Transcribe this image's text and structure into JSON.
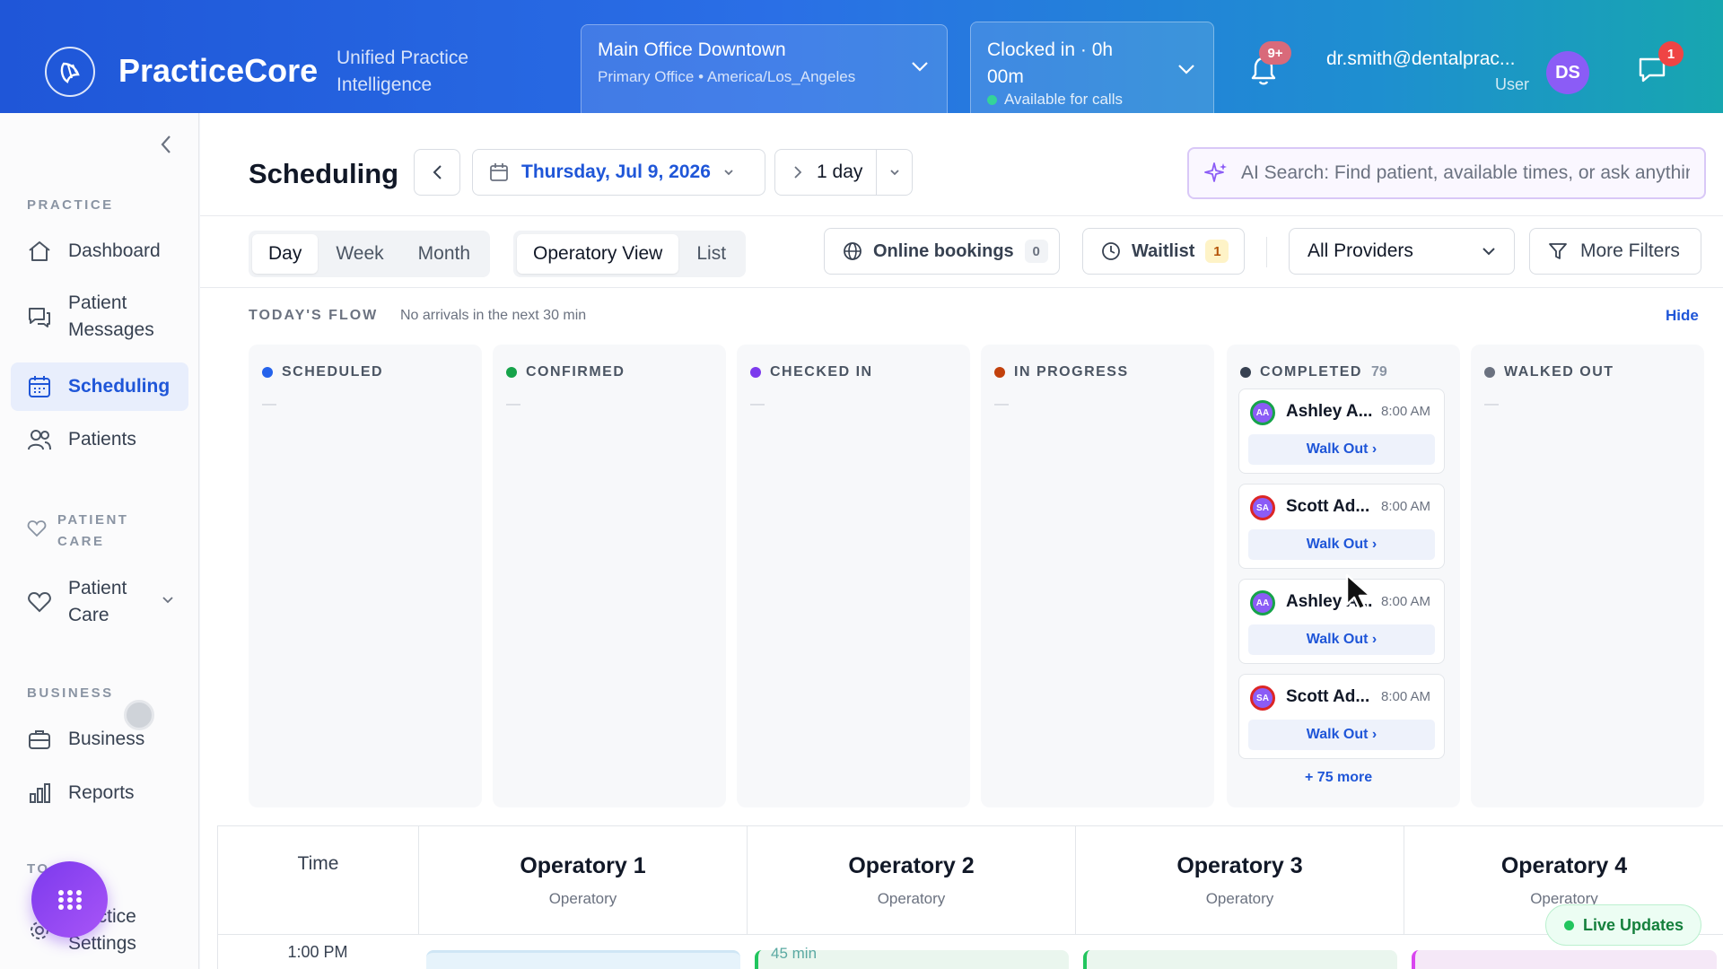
{
  "header": {
    "brand": "PracticeCore",
    "tagline": "Unified Practice Intelligence",
    "office": {
      "title": "Main Office Downtown",
      "subtitle": "Primary Office • America/Los_Angeles"
    },
    "clock": {
      "title": "Clocked in · 0h 00m",
      "status": "Available for calls"
    },
    "notifications_badge": "9+",
    "user": {
      "email": "dr.smith@dentalprac...",
      "role": "User",
      "initials": "DS"
    },
    "messages_badge": "1"
  },
  "sidebar": {
    "sections": [
      {
        "label": "PRACTICE"
      },
      {
        "label": "PATIENT CARE"
      },
      {
        "label": "BUSINESS"
      },
      {
        "label": "TO"
      }
    ],
    "items": [
      {
        "label": "Dashboard",
        "icon": "home-icon"
      },
      {
        "label": "Patient Messages",
        "icon": "chat-bubbles-icon"
      },
      {
        "label": "Scheduling",
        "icon": "calendar-icon",
        "active": true
      },
      {
        "label": "Patients",
        "icon": "users-icon"
      },
      {
        "label": "Patient Care",
        "icon": "heart-icon"
      },
      {
        "label": "Business",
        "icon": "briefcase-icon"
      },
      {
        "label": "Reports",
        "icon": "bar-chart-icon"
      },
      {
        "label": "Practice Settings",
        "icon": "gear-icon"
      }
    ],
    "patient_care_section_icon": "heart-icon"
  },
  "toolbar": {
    "title": "Scheduling",
    "date": "Thursday, Jul 9, 2026",
    "range": "1 day",
    "search_placeholder": "AI Search: Find patient, available times, or ask anything"
  },
  "filters": {
    "views": [
      "Day",
      "Week",
      "Month"
    ],
    "active_view": "Day",
    "modes": [
      "Operatory View",
      "List"
    ],
    "active_mode": "Operatory View",
    "online_bookings": {
      "label": "Online bookings",
      "count": "0"
    },
    "waitlist": {
      "label": "Waitlist",
      "count": "1"
    },
    "providers": "All Providers",
    "more_filters": "More Filters"
  },
  "flow": {
    "label": "TODAY'S FLOW",
    "note": "No arrivals in the next 30 min",
    "hide": "Hide",
    "columns": [
      {
        "label": "SCHEDULED",
        "color": "#2563eb",
        "count": "",
        "empty": "—"
      },
      {
        "label": "CONFIRMED",
        "color": "#16a34a",
        "count": "",
        "empty": "—"
      },
      {
        "label": "CHECKED IN",
        "color": "#7c3aed",
        "count": "",
        "empty": "—"
      },
      {
        "label": "IN PROGRESS",
        "color": "#c2410c",
        "count": "",
        "empty": "—"
      },
      {
        "label": "COMPLETED",
        "color": "#374151",
        "count": "79",
        "empty": ""
      },
      {
        "label": "WALKED OUT",
        "color": "#6b7280",
        "count": "",
        "empty": "—"
      }
    ],
    "completed_cards": [
      {
        "name": "Ashley A...",
        "time": "8:00 AM",
        "initials": "AA",
        "action": "Walk Out ›"
      },
      {
        "name": "Scott Ad...",
        "time": "8:00 AM",
        "initials": "SA",
        "action": "Walk Out ›"
      },
      {
        "name": "Ashley A...",
        "time": "8:00 AM",
        "initials": "AA",
        "action": "Walk Out ›"
      },
      {
        "name": "Scott Ad...",
        "time": "8:00 AM",
        "initials": "SA",
        "action": "Walk Out ›"
      }
    ],
    "more": "+ 75 more"
  },
  "grid": {
    "time_header": "Time",
    "operatories": [
      {
        "name": "Operatory 1",
        "type": "Operatory"
      },
      {
        "name": "Operatory 2",
        "type": "Operatory"
      },
      {
        "name": "Operatory 3",
        "type": "Operatory"
      },
      {
        "name": "Operatory 4",
        "type": "Operatory"
      }
    ],
    "first_time": "1:00 PM",
    "duration_label": "45 min"
  },
  "live_updates": "Live Updates"
}
